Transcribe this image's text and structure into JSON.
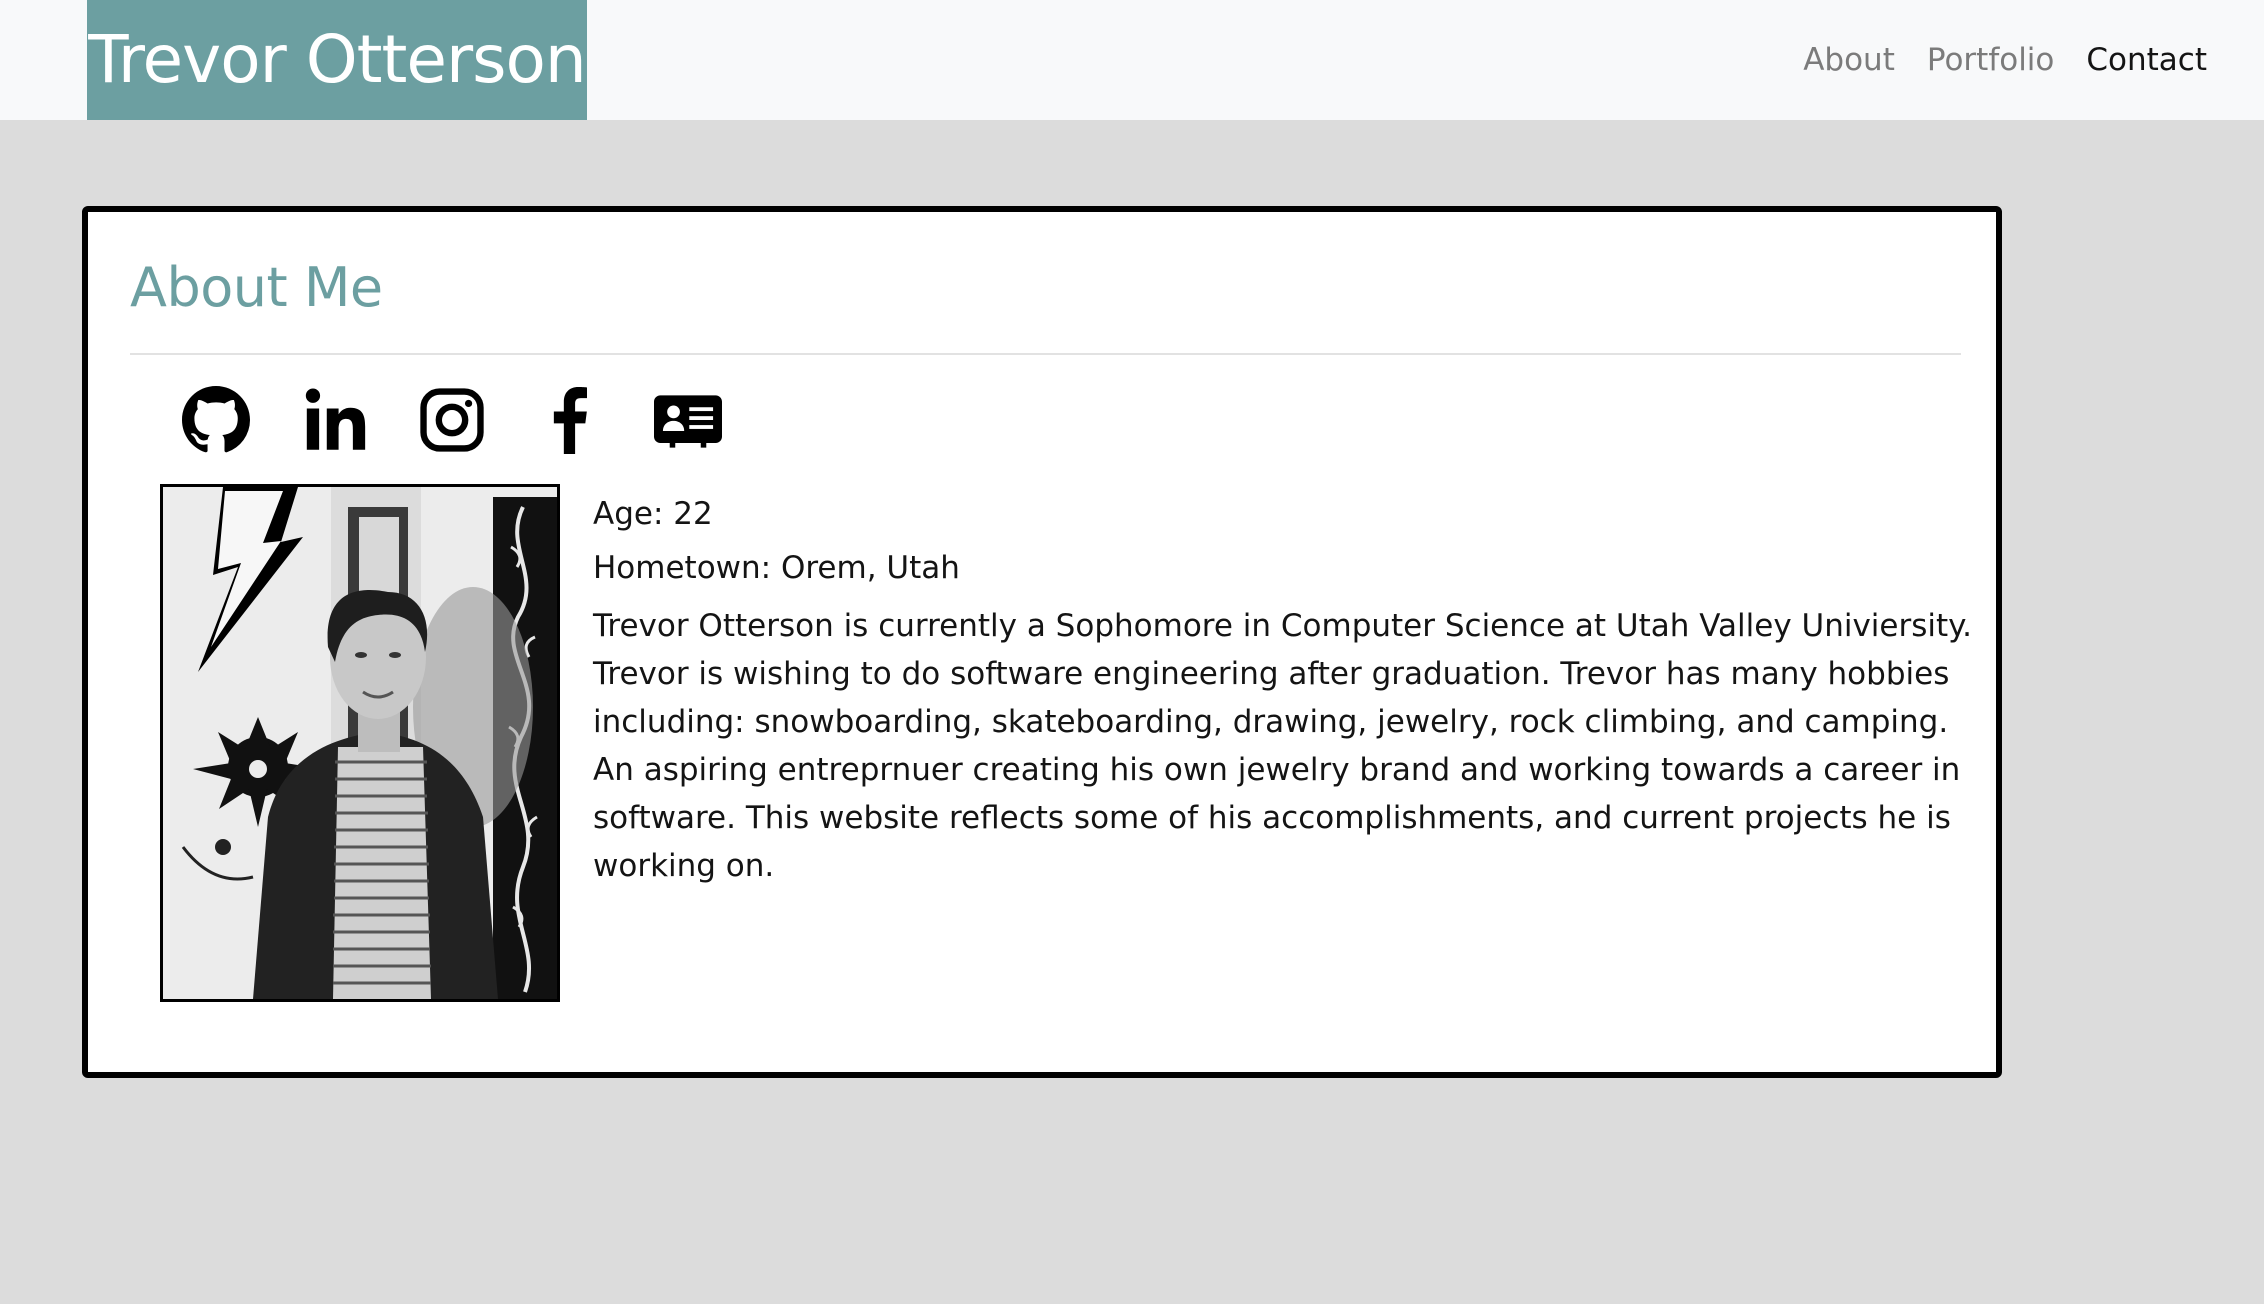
{
  "navbar": {
    "brand": "Trevor Otterson",
    "links": [
      {
        "label": "About"
      },
      {
        "label": "Portfolio"
      },
      {
        "label": "Contact"
      }
    ]
  },
  "about": {
    "title": "About Me",
    "social_icons": [
      "github-icon",
      "linkedin-icon",
      "instagram-icon",
      "facebook-icon",
      "contact-card-icon"
    ],
    "age": "Age: 22",
    "hometown": "Hometown: Orem, Utah",
    "bio": "Trevor Otterson is currently a Sophomore in Computer Science at Utah Valley Univiersity. Trevor is wishing to do software engineering after graduation. Trevor has many hobbies including: snowboarding, skateboarding, drawing, jewelry, rock climbing, and camping. An aspiring entreprnuer creating his own jewelry brand and working towards a career in software. This website reflects some of his accomplishments, and current projects he is working on."
  },
  "colors": {
    "accent": "#6c9fa1",
    "background": "#dcdcdc",
    "navbar": "#f8f9fa"
  }
}
